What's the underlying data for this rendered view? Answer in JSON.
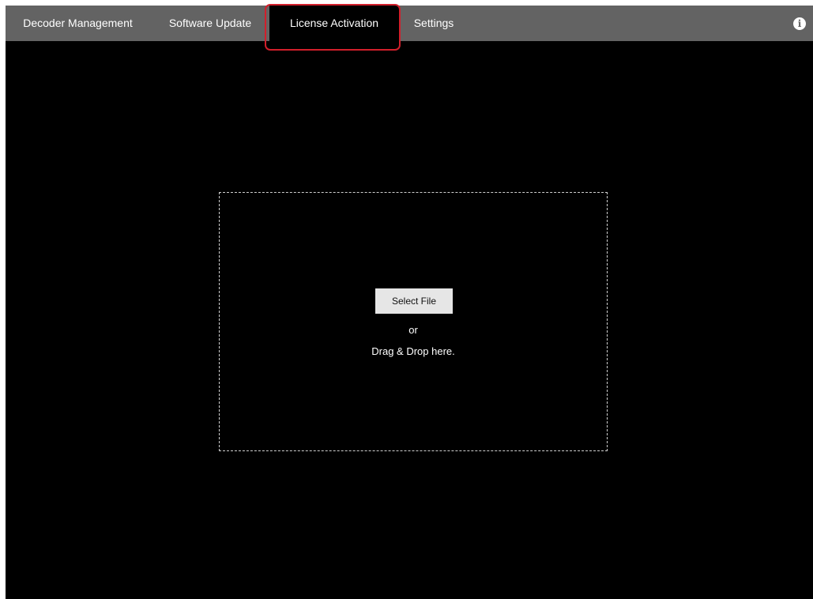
{
  "nav": {
    "tabs": [
      {
        "label": "Decoder Management",
        "active": false
      },
      {
        "label": "Software Update",
        "active": false
      },
      {
        "label": "License Activation",
        "active": true
      },
      {
        "label": "Settings",
        "active": false
      }
    ],
    "info_icon": "info-icon"
  },
  "dropzone": {
    "select_button_label": "Select File",
    "or_text": "or",
    "drag_drop_text": "Drag & Drop here."
  },
  "colors": {
    "topbar_bg": "#636363",
    "content_bg": "#000000",
    "highlight": "#d21f2b",
    "button_bg": "#e6e6e6"
  }
}
